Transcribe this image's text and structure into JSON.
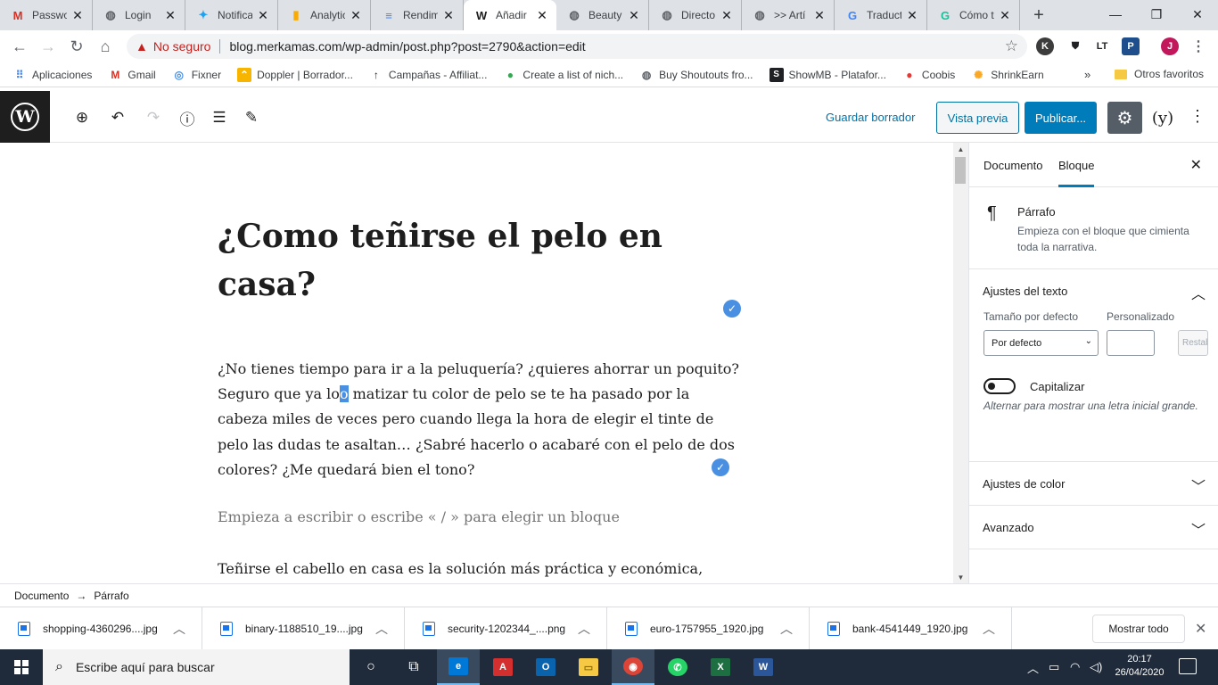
{
  "browser": {
    "tabs": [
      {
        "title": "Passwo",
        "icon": "gmail-icon"
      },
      {
        "title": "Login",
        "icon": "globe-icon"
      },
      {
        "title": "Notifica",
        "icon": "twitter-icon"
      },
      {
        "title": "Analytic",
        "icon": "analytics-icon"
      },
      {
        "title": "Rendim",
        "icon": "page-icon"
      },
      {
        "title": "Añadir",
        "icon": "wordpress-icon"
      },
      {
        "title": "Beauty",
        "icon": "globe-icon"
      },
      {
        "title": "Directo",
        "icon": "globe-icon"
      },
      {
        "title": ">> Artí",
        "icon": "globe-icon"
      },
      {
        "title": "Traduct",
        "icon": "translate-icon"
      },
      {
        "title": "Cómo t",
        "icon": "grammarly-icon"
      }
    ],
    "address": {
      "insecure_label": "No seguro",
      "url": "blog.merkamas.com/wp-admin/post.php?post=2790&action=edit"
    },
    "bookmarks": [
      "Aplicaciones",
      "Gmail",
      "Fixner",
      "Doppler | Borrador...",
      "Campañas - Affiliat...",
      "Create a list of nich...",
      "Buy Shoutouts fro...",
      "ShowMB - Platafor...",
      "Coobis",
      "ShrinkEarn"
    ],
    "bookmarks_more": "»",
    "other_favorites": "Otros favoritos",
    "profile_initial": "J"
  },
  "wp": {
    "header": {
      "save_draft": "Guardar borrador",
      "preview": "Vista previa",
      "publish": "Publicar..."
    },
    "post": {
      "title": "¿Como teñirse el pelo en casa?",
      "p1_before": "¿No tienes tiempo para ir a la peluquería? ¿quieres ahorrar un poquito? Seguro que ya lo",
      "p1_highlight": "o",
      "p1_after": " matizar tu color de pelo se te ha pasado por la cabeza miles de veces pero cuando llega la hora de elegir el tinte de pelo las dudas te asaltan… ¿Sabré hacerlo o acabaré con el pelo de dos colores? ¿Me quedará bien el tono?",
      "placeholder": "Empieza a escribir o escribe « / » para elegir un bloque",
      "p2": "Teñirse el cabello en casa es la solución más práctica y económica, siempre"
    },
    "sidebar": {
      "tab_document": "Documento",
      "tab_block": "Bloque",
      "block_name": "Párrafo",
      "block_desc": "Empieza con el bloque que cimienta toda la narrativa.",
      "text_settings": "Ajustes del texto",
      "size_default_label": "Tamaño por defecto",
      "custom_label": "Personalizado",
      "size_select_value": "Por defecto",
      "reset": "Restablecer",
      "capitalize_label": "Capitalizar",
      "capitalize_help": "Alternar para mostrar una letra inicial grande.",
      "color_settings": "Ajustes de color",
      "advanced": "Avanzado"
    },
    "breadcrumb": {
      "root": "Documento",
      "arrow": "→",
      "current": "Párrafo"
    }
  },
  "downloads": {
    "items": [
      "shopping-4360296....jpg",
      "binary-1188510_19....jpg",
      "security-1202344_....png",
      "euro-1757955_1920.jpg",
      "bank-4541449_1920.jpg"
    ],
    "show_all": "Mostrar todo"
  },
  "taskbar": {
    "search_placeholder": "Escribe aquí para buscar",
    "time": "20:17",
    "date": "26/04/2020"
  },
  "colors": {
    "wp_blue": "#007cba",
    "wp_dark": "#1e1e1e",
    "insecure_red": "#c5221f",
    "taskbar": "#1f2b3a"
  }
}
